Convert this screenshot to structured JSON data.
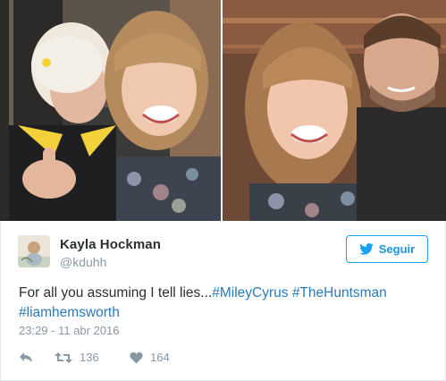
{
  "photos": {
    "left_alt": "",
    "right_alt": ""
  },
  "tweet": {
    "user": {
      "name": "Kayla Hockman",
      "handle": "@kduhh"
    },
    "follow_label": "Seguir",
    "text_plain": "For all you assuming I tell lies...",
    "hashtags": [
      "#MileyCyrus",
      "#TheHuntsman",
      "#liamhemsworth"
    ],
    "timestamp": "23:29 - 11 abr 2016",
    "retweet_count": "136",
    "like_count": "164"
  },
  "colors": {
    "accent": "#1da1f2",
    "hashtag": "#2b7bb9",
    "muted": "#8899a6",
    "text": "#292f33"
  },
  "icons": {
    "follow": "bird-icon",
    "reply": "reply-icon",
    "retweet": "retweet-icon",
    "like": "heart-icon"
  }
}
